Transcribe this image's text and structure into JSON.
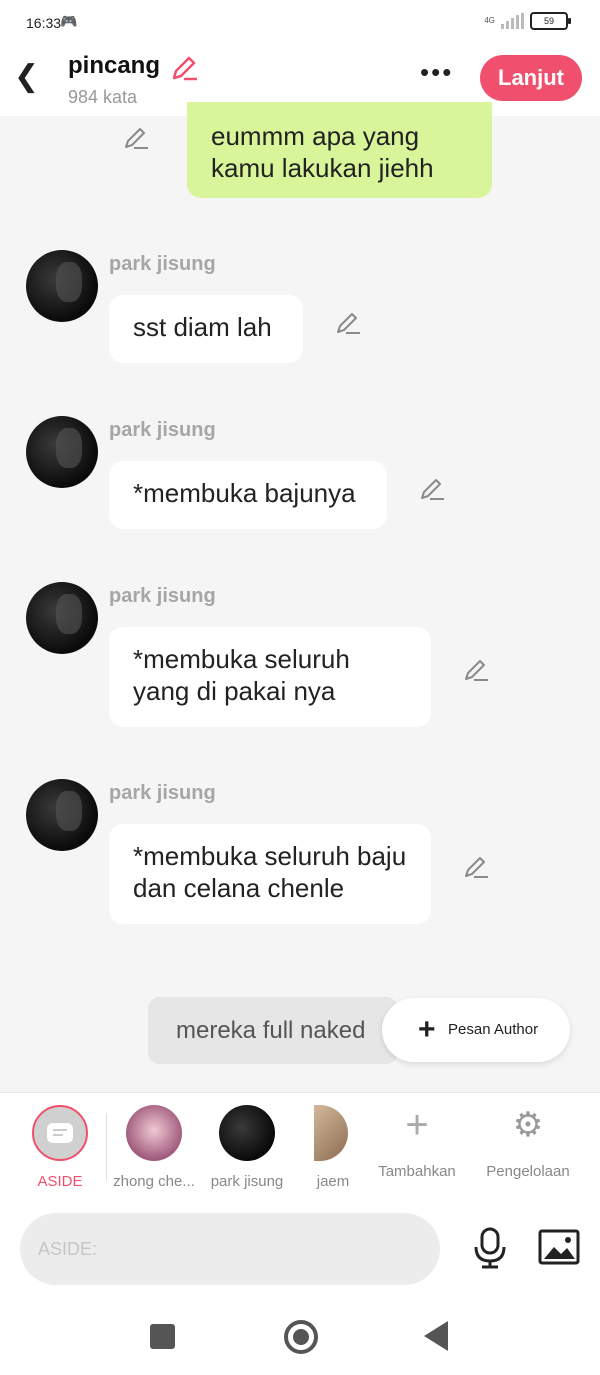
{
  "status_bar": {
    "time": "16:33",
    "network": "4G",
    "battery": "59"
  },
  "header": {
    "title": "pincang",
    "word_count": "984 kata",
    "next_label": "Lanjut"
  },
  "messages": {
    "outgoing": "eummm apa yang kamu lakukan jiehh",
    "incoming": [
      {
        "sender": "park jisung",
        "text": "sst diam lah"
      },
      {
        "sender": "park jisung",
        "text": "*membuka bajunya"
      },
      {
        "sender": "park jisung",
        "text": "*membuka seluruh yang di pakai nya"
      },
      {
        "sender": "park jisung",
        "text": "*membuka seluruh baju dan celana chenle"
      }
    ]
  },
  "narration": {
    "text": "mereka full naked"
  },
  "author_button": {
    "label": "Pesan Author"
  },
  "characters": [
    {
      "name": "ASIDE",
      "color": "#f0506e"
    },
    {
      "name": "zhong che..."
    },
    {
      "name": "park jisung"
    },
    {
      "name": "jaem"
    },
    {
      "name": "Tambahkan"
    },
    {
      "name": "Pengelolaan"
    }
  ],
  "composer": {
    "placeholder": "ASIDE:"
  },
  "colors": {
    "accent": "#f0506e",
    "outgoing_bubble": "#d9f59a"
  },
  "icons": [
    "back-icon",
    "edit-icon",
    "more-icon",
    "plus-icon",
    "gear-icon",
    "microphone-icon",
    "image-icon"
  ]
}
